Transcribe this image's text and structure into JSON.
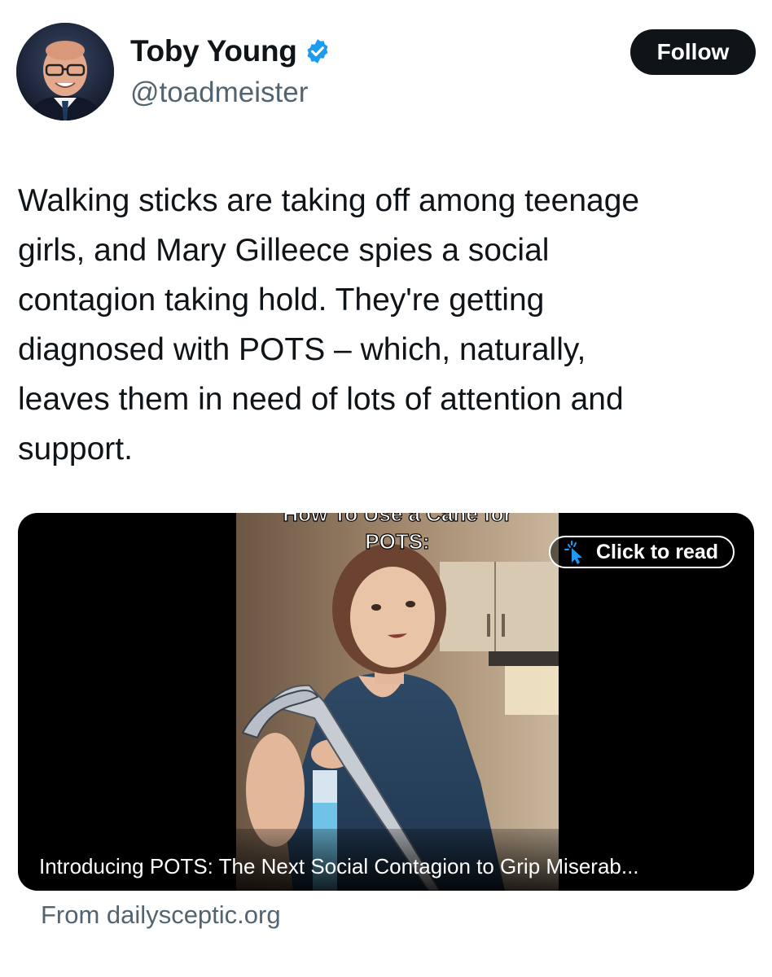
{
  "author": {
    "display_name": "Toby Young",
    "handle": "@toadmeister",
    "verified_icon": "verified-badge-icon"
  },
  "follow_button": {
    "label": "Follow"
  },
  "tweet": {
    "lines": [
      "Walking sticks are taking off among teenage",
      "girls, and Mary Gilleece spies a social",
      "contagion taking hold. They're getting",
      "diagnosed with POTS – which, naturally,",
      "leaves them in need of lots of attention and",
      "support."
    ]
  },
  "card": {
    "video_overlay_line1": "How To Use a Cane for",
    "video_overlay_line2": "POTS:",
    "click_label": "Click to read",
    "headline": "Introducing POTS: The Next Social Contagion to Grip Miserab...",
    "source": "From dailysceptic.org"
  },
  "colors": {
    "text": "#0f1419",
    "secondary": "#536471",
    "verified": "#1d9bf0",
    "follow_bg": "#0f1419"
  }
}
